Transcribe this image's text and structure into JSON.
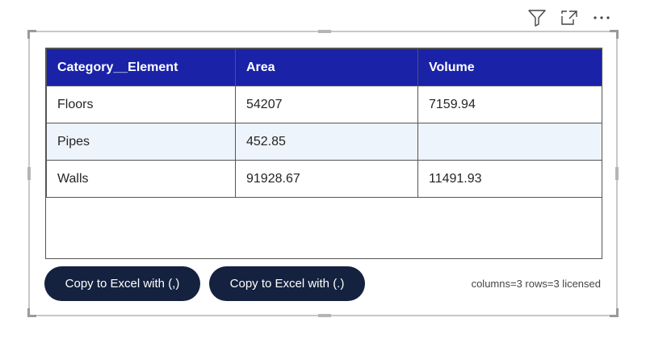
{
  "header_icons": [
    "filter-icon",
    "focus-mode-icon",
    "more-options-icon"
  ],
  "table": {
    "columns": [
      "Category__Element",
      "Area",
      "Volume"
    ],
    "rows": [
      [
        "Floors",
        "54207",
        "7159.94"
      ],
      [
        "Pipes",
        "452.85",
        ""
      ],
      [
        "Walls",
        "91928.67",
        "11491.93"
      ]
    ]
  },
  "buttons": {
    "copy_comma": "Copy to Excel with (,)",
    "copy_dot": "Copy to Excel with (.)"
  },
  "status": "columns=3 rows=3 licensed",
  "colors": {
    "header_bg": "#1a22a8",
    "button_bg": "#14213f",
    "alt_row_bg": "#eef4fc"
  }
}
